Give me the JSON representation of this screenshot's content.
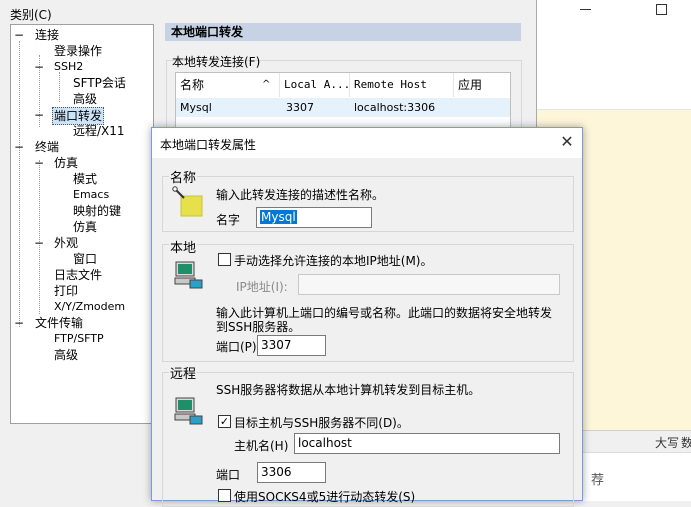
{
  "background_window": {
    "status": {
      "caps": "大写",
      "num": "数"
    },
    "lower_text": "荐"
  },
  "options": {
    "category_label": "类别(C)",
    "tree": [
      {
        "label": "连接",
        "expander": "−"
      },
      {
        "label": "登录操作"
      },
      {
        "label": "SSH2",
        "expander": "−"
      },
      {
        "label": "SFTP会话"
      },
      {
        "label": "高级"
      },
      {
        "label": "端口转发",
        "expander": "−"
      },
      {
        "label": "远程/X11"
      },
      {
        "label": "终端",
        "expander": "−"
      },
      {
        "label": "仿真",
        "expander": "−"
      },
      {
        "label": "模式"
      },
      {
        "label": "Emacs"
      },
      {
        "label": "映射的键"
      },
      {
        "label": "仿真"
      },
      {
        "label": "外观",
        "expander": "−"
      },
      {
        "label": "窗口"
      },
      {
        "label": "日志文件"
      },
      {
        "label": "打印"
      },
      {
        "label": "X/Y/Zmodem"
      },
      {
        "label": "文件传输",
        "expander": "−"
      },
      {
        "label": "FTP/SFTP"
      },
      {
        "label": "高级"
      }
    ],
    "panel_header": "本地端口转发",
    "fwd_group_label": "本地转发连接(F)",
    "table": {
      "columns": [
        "名称",
        "Local A...",
        "Remote Host",
        "应用"
      ],
      "sort_indicator": "^",
      "rows": [
        {
          "name": "Mysql",
          "local": "3307",
          "remote": "localhost:3306",
          "app": ""
        }
      ]
    }
  },
  "properties": {
    "title": "本地端口转发属性",
    "close": "✕",
    "name_group": {
      "label": "名称",
      "description": "输入此转发连接的描述性名称。",
      "field_label": "名字",
      "field_value": "Mysql"
    },
    "local_group": {
      "label": "本地",
      "manual_ip_checkbox": "手动选择允许连接的本地IP地址(M)。",
      "ip_label": "IP地址(I):",
      "ip_value": "",
      "description_line1": "输入此计算机上端口的编号或名称。此端口的数据将安全地转发",
      "description_line2": "到SSH服务器。",
      "port_label": "端口(P)",
      "port_value": "3307"
    },
    "remote_group": {
      "label": "远程",
      "description": "SSH服务器将数据从本地计算机转发到目标主机。",
      "diff_host_checkbox": "目标主机与SSH服务器不同(D)。",
      "diff_host_checked": "✓",
      "hostname_label": "主机名(H)",
      "hostname_value": "localhost",
      "port_label": "端口",
      "port_value": "3306",
      "socks_checkbox": "使用SOCKS4或5进行动态转发(S)"
    }
  }
}
